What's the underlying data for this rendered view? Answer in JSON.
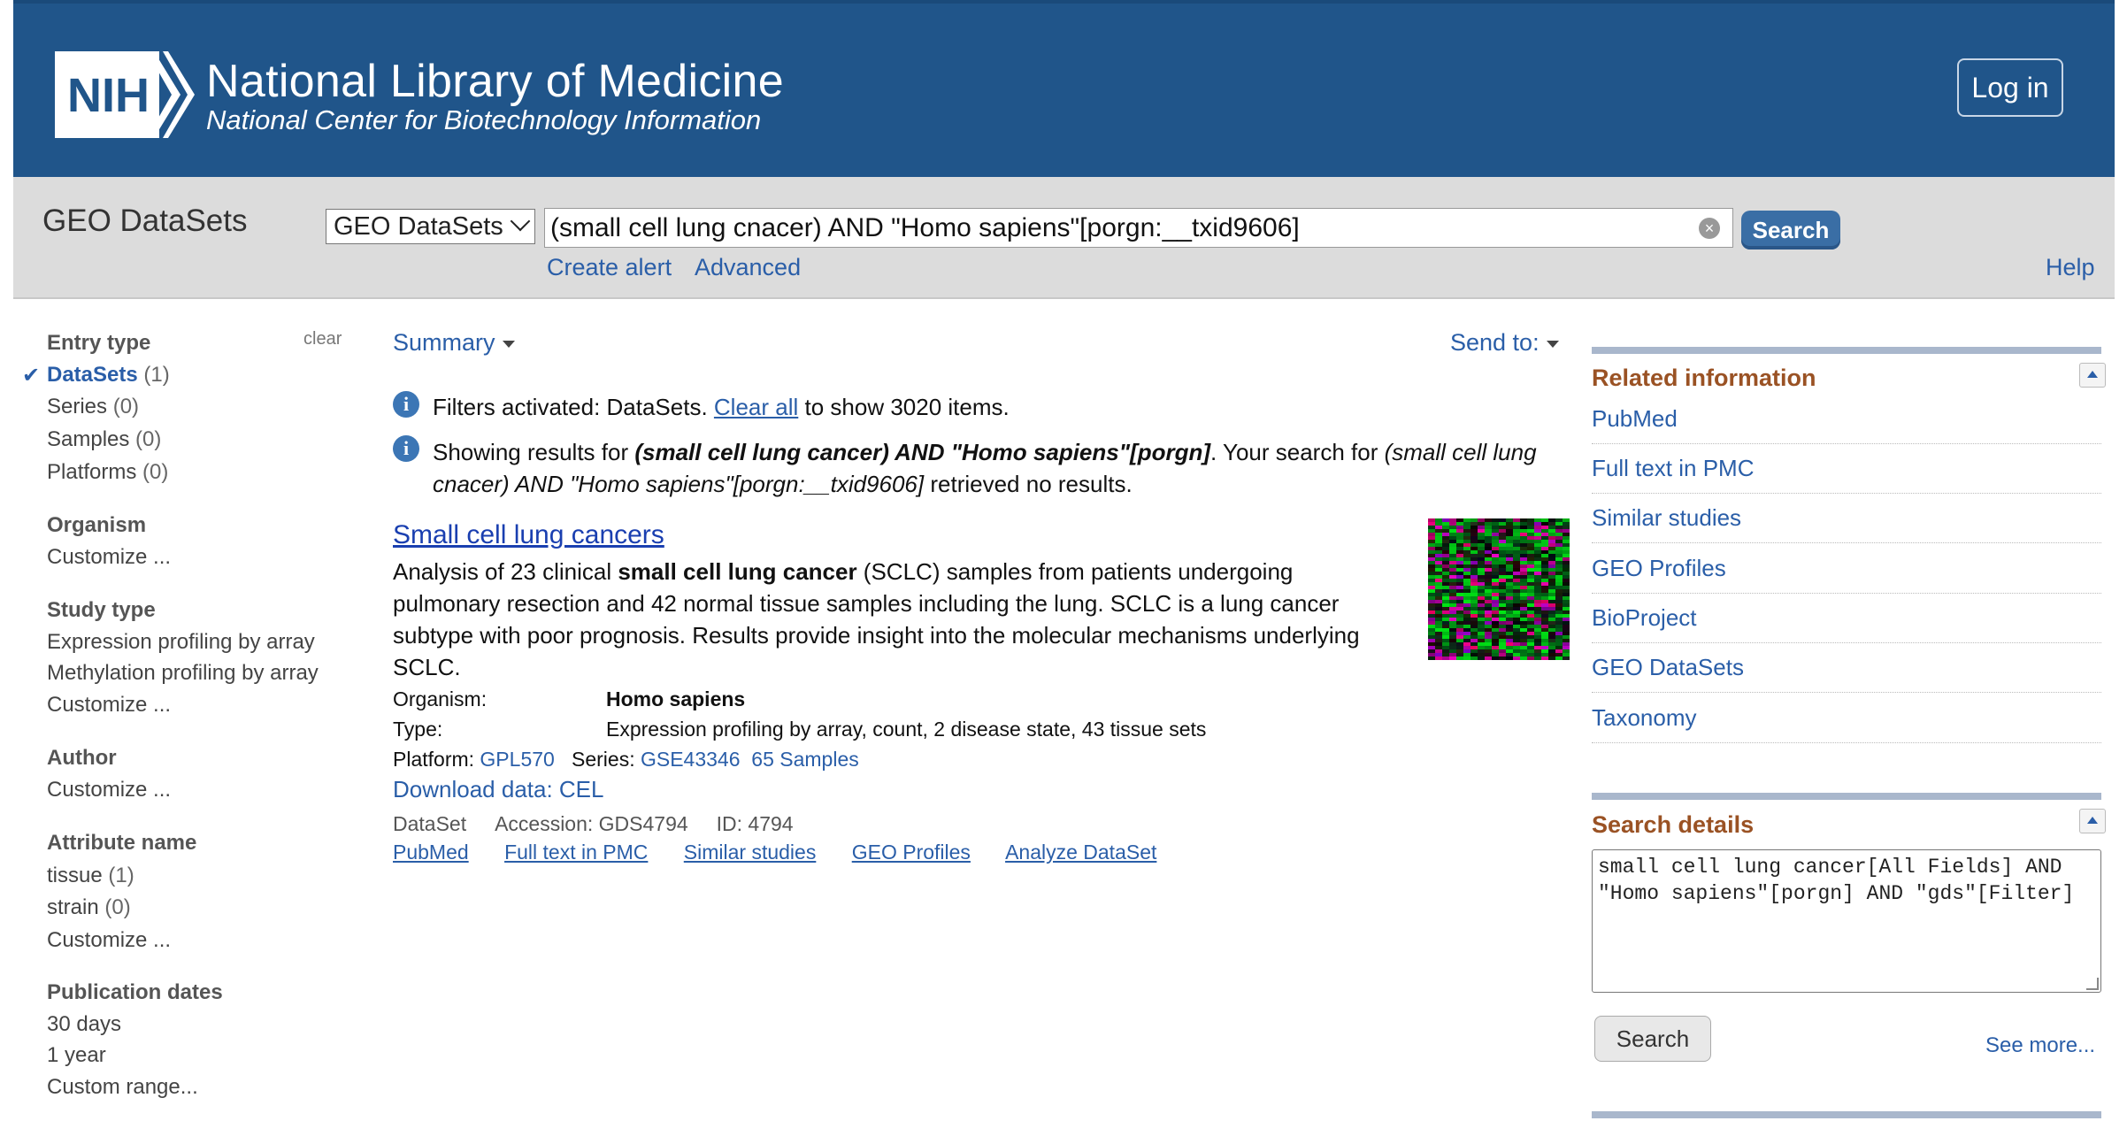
{
  "header": {
    "logo_text": "NIH",
    "title": "National Library of Medicine",
    "subtitle": "National Center for Biotechnology Information",
    "login_label": "Log in"
  },
  "search_bar": {
    "db_title": "GEO DataSets",
    "db_select_value": "GEO DataSets",
    "query": "(small cell lung cnacer) AND \"Homo sapiens\"[porgn:__txid9606]",
    "search_label": "Search",
    "create_alert": "Create alert",
    "advanced": "Advanced",
    "help": "Help"
  },
  "sidebar": {
    "clear": "clear",
    "entry_type": {
      "heading": "Entry type",
      "items": [
        {
          "label": "DataSets",
          "count": "(1)",
          "selected": true
        },
        {
          "label": "Series",
          "count": "(0)"
        },
        {
          "label": "Samples",
          "count": "(0)"
        },
        {
          "label": "Platforms",
          "count": "(0)"
        }
      ]
    },
    "organism": {
      "heading": "Organism",
      "items": [
        "Customize ..."
      ]
    },
    "study_type": {
      "heading": "Study type",
      "items": [
        "Expression profiling by array",
        "Methylation profiling by array",
        "Customize ..."
      ]
    },
    "author": {
      "heading": "Author",
      "items": [
        "Customize ..."
      ]
    },
    "attribute_name": {
      "heading": "Attribute name",
      "items": [
        {
          "label": "tissue",
          "count": "(1)"
        },
        {
          "label": "strain",
          "count": "(0)"
        },
        {
          "label": "Customize ...",
          "count": ""
        }
      ]
    },
    "publication_dates": {
      "heading": "Publication dates",
      "items": [
        "30 days",
        "1 year",
        "Custom range..."
      ]
    }
  },
  "main": {
    "summary_label": "Summary",
    "send_to_label": "Send to:",
    "filter_msg": {
      "prefix": "Filters activated: DataSets. ",
      "link": "Clear all",
      "suffix": " to show 3020 items."
    },
    "showing_msg": {
      "prefix": "Showing results for ",
      "query_bold": "(small cell lung cancer) AND \"Homo sapiens\"[porgn]",
      "middle": ". Your search for ",
      "original_query": "(small cell lung cnacer) AND \"Homo sapiens\"[porgn:__txid9606]",
      "suffix": " retrieved no results."
    },
    "result": {
      "title": "Small cell lung cancers",
      "desc_prefix": "Analysis of 23 clinical ",
      "desc_bold": "small cell lung cancer",
      "desc_suffix": " (SCLC) samples from patients undergoing pulmonary resection and 42 normal tissue samples including the lung. SCLC is a lung cancer subtype with poor prognosis. Results provide insight into the molecular mechanisms underlying SCLC.",
      "organism_label": "Organism:",
      "organism_value": "Homo sapiens",
      "type_label": "Type:",
      "type_value": "Expression profiling by array, count, 2 disease state, 43 tissue sets",
      "platform_label": "Platform:",
      "platform_value": "GPL570",
      "series_label": "Series:",
      "series_value": "GSE43346",
      "samples_value": "65 Samples",
      "download": "Download data: CEL",
      "dataset_label": "DataSet",
      "accession": "Accession: GDS4794",
      "id": "ID: 4794",
      "links": [
        "PubMed",
        "Full text in PMC",
        "Similar studies",
        "GEO Profiles",
        "Analyze DataSet"
      ]
    }
  },
  "right": {
    "related_title": "Related information",
    "related_items": [
      "PubMed",
      "Full text in PMC",
      "Similar studies",
      "GEO Profiles",
      "BioProject",
      "GEO DataSets",
      "Taxonomy"
    ],
    "details_title": "Search details",
    "details_text": "small cell lung cancer[All Fields] AND \"Homo sapiens\"[porgn] AND \"gds\"[Filter]",
    "details_search": "Search",
    "see_more": "See more..."
  },
  "colors": {
    "header_bg": "#20558a",
    "search_bar_bg": "#dcdcdc",
    "link": "#2a5ea8",
    "portlet_title": "#9a5224",
    "search_button": "#3a6ea5"
  }
}
